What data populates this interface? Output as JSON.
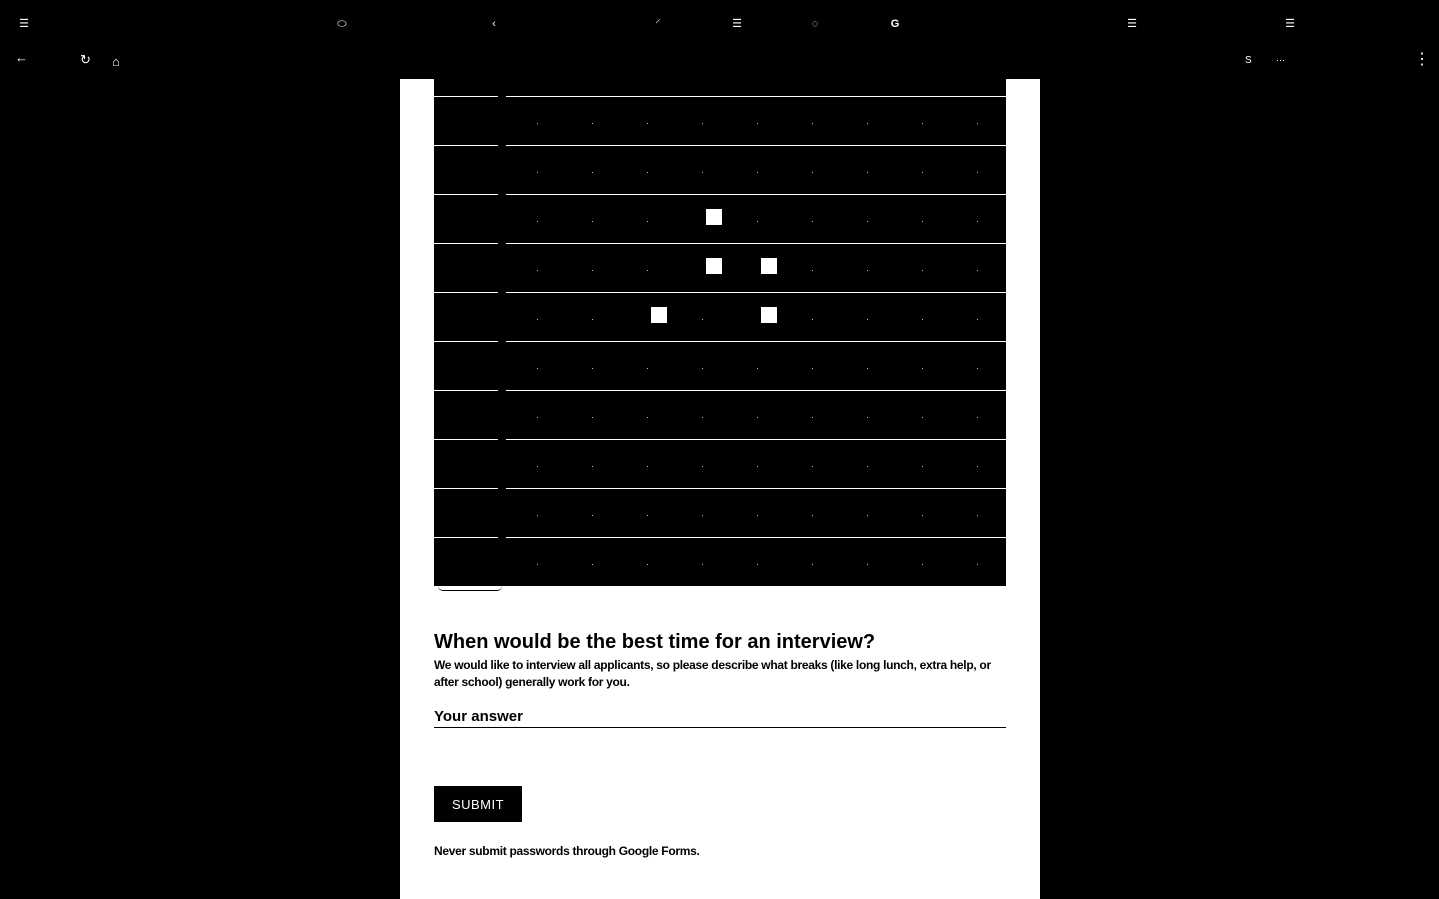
{
  "browser": {
    "tabs": [
      {
        "icon": "list-icon",
        "glyph": "☰"
      },
      {
        "icon": "oval-icon",
        "glyph": "⬭"
      },
      {
        "icon": "arc-icon",
        "glyph": "‹"
      },
      {
        "icon": "feather-icon",
        "glyph": "⸍"
      },
      {
        "icon": "list-icon",
        "glyph": "☰"
      },
      {
        "icon": "loading-icon",
        "glyph": "◌"
      },
      {
        "icon": "google-icon",
        "glyph": "G"
      },
      {
        "icon": "list-icon",
        "glyph": "☰"
      },
      {
        "icon": "list-icon",
        "glyph": "☰"
      }
    ],
    "toolbar": {
      "back_glyph": "←",
      "reload_glyph": "↻",
      "home_glyph": "⌂",
      "profile_letter": "S",
      "extension_glyph": "⋯",
      "menu_glyph": "⋮"
    }
  },
  "grid": {
    "columns": 9,
    "rows": 10,
    "checked": [
      [
        2,
        3
      ],
      [
        3,
        3
      ],
      [
        3,
        4
      ],
      [
        4,
        2
      ],
      [
        4,
        4
      ]
    ]
  },
  "question": {
    "title": "When would be the best time for an interview?",
    "description": "We would like to interview all applicants, so please describe what breaks (like long lunch, extra help, or after school) generally work for you.",
    "answer_placeholder": "Your answer"
  },
  "submit_label": "SUBMIT",
  "footer_note": "Never submit passwords through Google Forms."
}
